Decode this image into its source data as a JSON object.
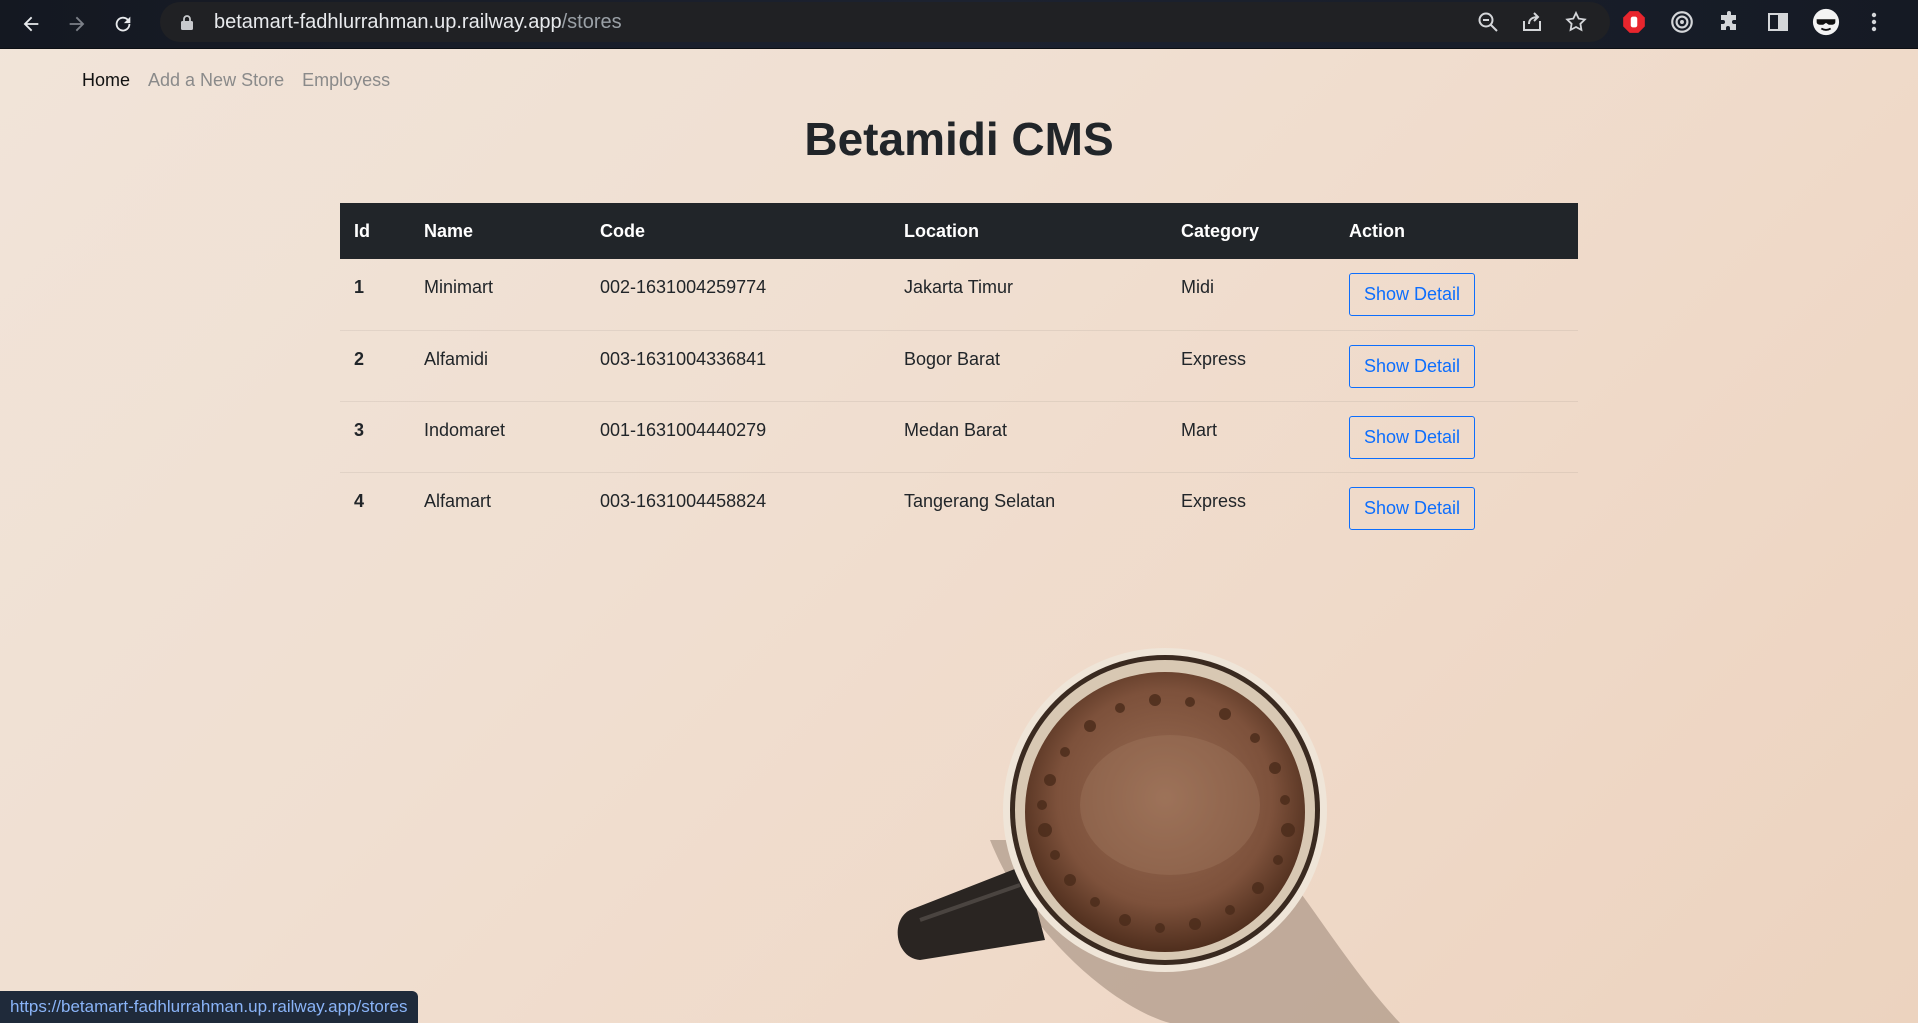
{
  "browser": {
    "url_host": "betamart-fadhlurrahman.up.railway.app",
    "url_path": "/stores",
    "status_url": "https://betamart-fadhlurrahman.up.railway.app/stores"
  },
  "nav": {
    "items": [
      {
        "label": "Home",
        "active": true
      },
      {
        "label": "Add a New Store",
        "active": false
      },
      {
        "label": "Employess",
        "active": false
      }
    ]
  },
  "page": {
    "title": "Betamidi CMS"
  },
  "table": {
    "headers": [
      "Id",
      "Name",
      "Code",
      "Location",
      "Category",
      "Action"
    ],
    "rows": [
      {
        "id": "1",
        "name": "Minimart",
        "code": "002-1631004259774",
        "location": "Jakarta Timur",
        "category": "Midi",
        "action": "Show Detail"
      },
      {
        "id": "2",
        "name": "Alfamidi",
        "code": "003-1631004336841",
        "location": "Bogor Barat",
        "category": "Express",
        "action": "Show Detail"
      },
      {
        "id": "3",
        "name": "Indomaret",
        "code": "001-1631004440279",
        "location": "Medan Barat",
        "category": "Mart",
        "action": "Show Detail"
      },
      {
        "id": "4",
        "name": "Alfamart",
        "code": "003-1631004458824",
        "location": "Tangerang Selatan",
        "category": "Express",
        "action": "Show Detail"
      }
    ]
  },
  "colors": {
    "table_header_bg": "#212529",
    "button_accent": "#0d6efd",
    "browser_bar": "#1c2230"
  },
  "icons": {
    "toolbar": [
      "back-icon",
      "forward-icon",
      "reload-icon"
    ],
    "omnibox": [
      "lock-icon",
      "zoom-icon",
      "share-icon",
      "bookmark-star-icon"
    ],
    "extensions": [
      "adblock-icon",
      "target-extension-icon",
      "puzzle-extensions-icon",
      "side-panel-icon",
      "profile-avatar-icon",
      "more-menu-icon"
    ]
  }
}
